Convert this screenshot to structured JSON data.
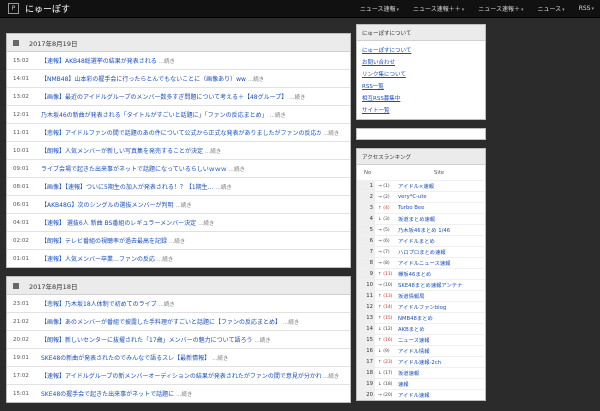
{
  "app": {
    "logo_glyph": "P",
    "title": "にゅーぽす"
  },
  "nav": [
    {
      "label": "ニュース速報"
    },
    {
      "label": "ニュース速報＋＋"
    },
    {
      "label": "ニュース速報＋"
    },
    {
      "label": "ニュース"
    },
    {
      "label": "RSS"
    }
  ],
  "days": [
    {
      "date": "2017年8月19日",
      "rows": [
        {
          "time": "15:02",
          "title": "【速報】AKB48総選挙の結果が発表される",
          "more": "...続き"
        },
        {
          "time": "14:01",
          "title": "【NMB48】山本彩の握手会に行ったらとんでもないことに（画像あり）ww",
          "more": "...続き"
        },
        {
          "time": "13:02",
          "title": "【画像】最近のアイドルグループのメンバー数多すぎ問題について考える＋【48グループ】",
          "more": "...続き"
        },
        {
          "time": "12:01",
          "title": "乃木坂46の新曲が発表される「タイトルがすごいと話題に」「ファンの反応まとめ」",
          "more": "...続き"
        },
        {
          "time": "11:01",
          "title": "【悲報】アイドルファンの間で話題のあの件について公式から正式な発表がありましたがファンの反応がすごいことになっている件",
          "more": "...続き"
        },
        {
          "time": "10:01",
          "title": "【朗報】人気メンバーが新しい写真集を発売することが決定",
          "more": "...続き"
        },
        {
          "time": "09:01",
          "title": "ライブ会場で起きた出来事がネットで話題になっているらしいｗｗｗ",
          "more": "...続き"
        },
        {
          "time": "08:01",
          "title": "【画像】【速報】ついに5期生の加入が発表される！？【1期生…",
          "more": "...続き"
        },
        {
          "time": "06:01",
          "title": "【AKB48G】次のシングルの選抜メンバーが判明",
          "more": "...続き"
        },
        {
          "time": "04:01",
          "title": "【速報】 選抜6人 新曲 BS番組のレギュラーメンバー決定",
          "more": "...続き"
        },
        {
          "time": "02:02",
          "title": "【朗報】テレビ番組の視聴率が過去最高を記録",
          "more": "...続き"
        },
        {
          "time": "01:01",
          "title": "【速報】人気メンバー卒業…ファンの反応",
          "more": "...続き"
        }
      ]
    },
    {
      "date": "2017年8月18日",
      "rows": [
        {
          "time": "23:01",
          "title": "【悲報】乃木坂18人体制で初めてのライブ",
          "more": "...続き"
        },
        {
          "time": "21:02",
          "title": "【画像】あのメンバーが番組で披露した手料理がすごいと話題に【ファンの反応まとめ】",
          "more": "...続き"
        },
        {
          "time": "20:02",
          "title": "【朗報】新しいセンターに抜擢された「17歳」メンバーの魅力について語ろう",
          "more": "...続き"
        },
        {
          "time": "19:01",
          "title": "SKE48の新曲が発表されたのでみんなで語るスレ【最新情報】",
          "more": "...続き"
        },
        {
          "time": "17:02",
          "title": "【速報】アイドルグループの新メンバーオーディションの結果が発表されたがファンの間で意見が分かれている件について",
          "more": "...続き"
        },
        {
          "time": "15:01",
          "title": "SKE48の握手会で起きた出来事がネットで話題に",
          "more": "...続き"
        }
      ]
    }
  ],
  "sidebar": {
    "links_panel": {
      "title": "にゅーぽすについて",
      "links": [
        "にゅーぽすについて",
        "お問い合わせ",
        "リンク集について",
        "RSS一覧",
        "相互RSS募集中",
        "サイト一覧"
      ]
    },
    "ranking": {
      "title": "アクセスランキング",
      "col_no": "No",
      "col_site": "Site",
      "rows": [
        {
          "no": "1",
          "mv": "→ (1)",
          "up": false,
          "site": "アイドル×速報"
        },
        {
          "no": "2",
          "mv": "→ (2)",
          "up": false,
          "site": "very*C-ute"
        },
        {
          "no": "3",
          "mv": "↑ (4)",
          "up": true,
          "site": "Turbo Bee"
        },
        {
          "no": "4",
          "mv": "↓ (3)",
          "up": false,
          "site": "坂道まとめ速報"
        },
        {
          "no": "5",
          "mv": "→ (5)",
          "up": false,
          "site": "乃木坂46まとめ 1/46"
        },
        {
          "no": "6",
          "mv": "→ (6)",
          "up": false,
          "site": "アイドルまとめ"
        },
        {
          "no": "7",
          "mv": "→ (7)",
          "up": false,
          "site": "ハロプロまとめ速報"
        },
        {
          "no": "8",
          "mv": "→ (8)",
          "up": false,
          "site": "アイドルニュース速報"
        },
        {
          "no": "9",
          "mv": "↑ (11)",
          "up": true,
          "site": "欅坂46まとめ"
        },
        {
          "no": "10",
          "mv": "→ (10)",
          "up": false,
          "site": "SKE48まとめ速報アンテナ"
        },
        {
          "no": "11",
          "mv": "↑ (13)",
          "up": true,
          "site": "坂道情報局"
        },
        {
          "no": "12",
          "mv": "↑ (14)",
          "up": true,
          "site": "アイドルファンblog"
        },
        {
          "no": "13",
          "mv": "↑ (15)",
          "up": true,
          "site": "NMB48まとめ"
        },
        {
          "no": "14",
          "mv": "↓ (12)",
          "up": false,
          "site": "AKBまとめ"
        },
        {
          "no": "15",
          "mv": "↑ (16)",
          "up": true,
          "site": "ニュース速報"
        },
        {
          "no": "16",
          "mv": "↓ (9)",
          "up": false,
          "site": "アイドル情報"
        },
        {
          "no": "17",
          "mv": "↑ (23)",
          "up": true,
          "site": "アイドル速報-2ch"
        },
        {
          "no": "18",
          "mv": "↓ (17)",
          "up": false,
          "site": "坂道速報"
        },
        {
          "no": "19",
          "mv": "↓ (18)",
          "up": false,
          "site": "速報"
        },
        {
          "no": "20",
          "mv": "→ (20)",
          "up": false,
          "site": "アイドル速報"
        }
      ]
    }
  }
}
